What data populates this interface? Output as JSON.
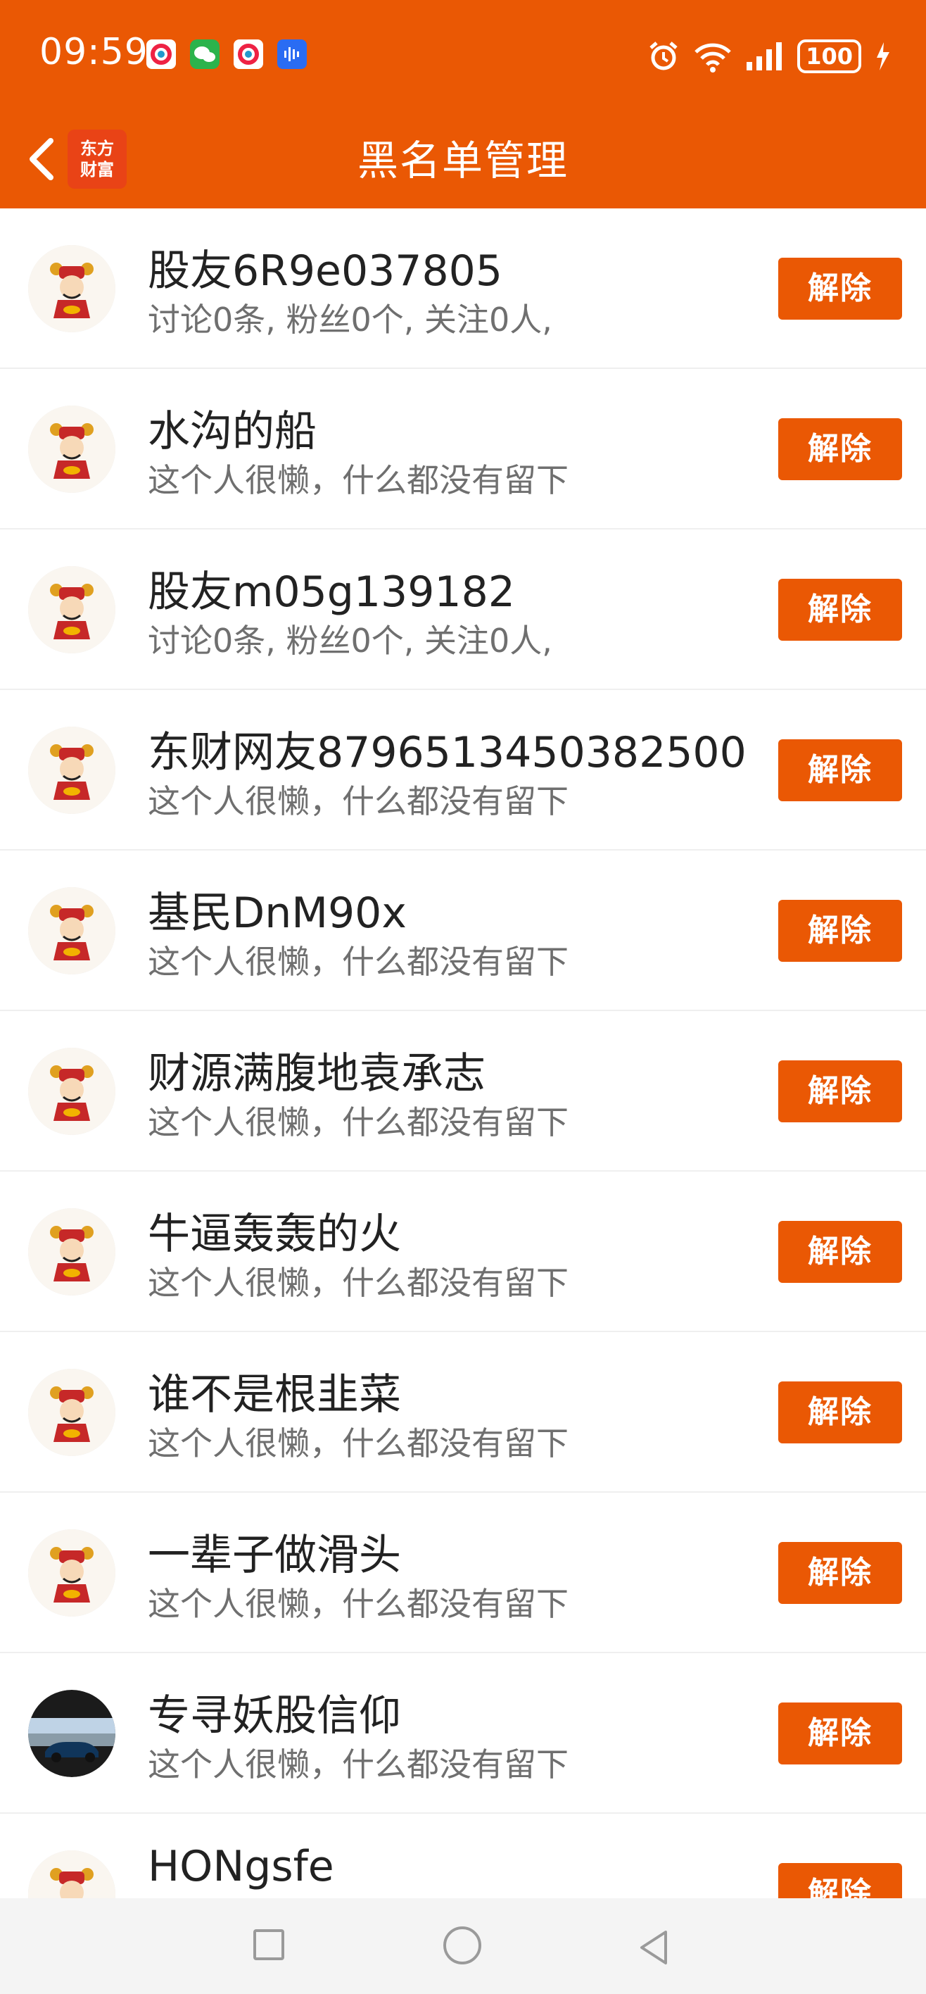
{
  "status_bar": {
    "time": "09:59",
    "battery": "100"
  },
  "header": {
    "title": "黑名单管理",
    "brand_line1": "东方",
    "brand_line2": "财富"
  },
  "colors": {
    "accent": "#EA5804"
  },
  "action_label": "解除",
  "items": [
    {
      "name": "股友6R9e037805",
      "desc": "讨论0条, 粉丝0个, 关注0人,",
      "avatar": "god-of-wealth"
    },
    {
      "name": "水沟的船",
      "desc": "这个人很懒，什么都没有留下",
      "avatar": "god-of-wealth"
    },
    {
      "name": "股友m05g139182",
      "desc": "讨论0条, 粉丝0个, 关注0人,",
      "avatar": "god-of-wealth"
    },
    {
      "name": "东财网友8796513450382500",
      "desc": "这个人很懒，什么都没有留下",
      "avatar": "god-of-wealth"
    },
    {
      "name": "基民DnM90x",
      "desc": "这个人很懒，什么都没有留下",
      "avatar": "god-of-wealth"
    },
    {
      "name": "财源满腹地袁承志",
      "desc": "这个人很懒，什么都没有留下",
      "avatar": "god-of-wealth"
    },
    {
      "name": "牛逼轰轰的火",
      "desc": "这个人很懒，什么都没有留下",
      "avatar": "god-of-wealth"
    },
    {
      "name": "谁不是根韭菜",
      "desc": "这个人很懒，什么都没有留下",
      "avatar": "god-of-wealth"
    },
    {
      "name": "一辈子做滑头",
      "desc": "这个人很懒，什么都没有留下",
      "avatar": "god-of-wealth"
    },
    {
      "name": "专寻妖股信仰",
      "desc": "这个人很懒，什么都没有留下",
      "avatar": "car-photo"
    },
    {
      "name": "HONgsfe",
      "desc": "",
      "avatar": "god-of-wealth"
    }
  ]
}
